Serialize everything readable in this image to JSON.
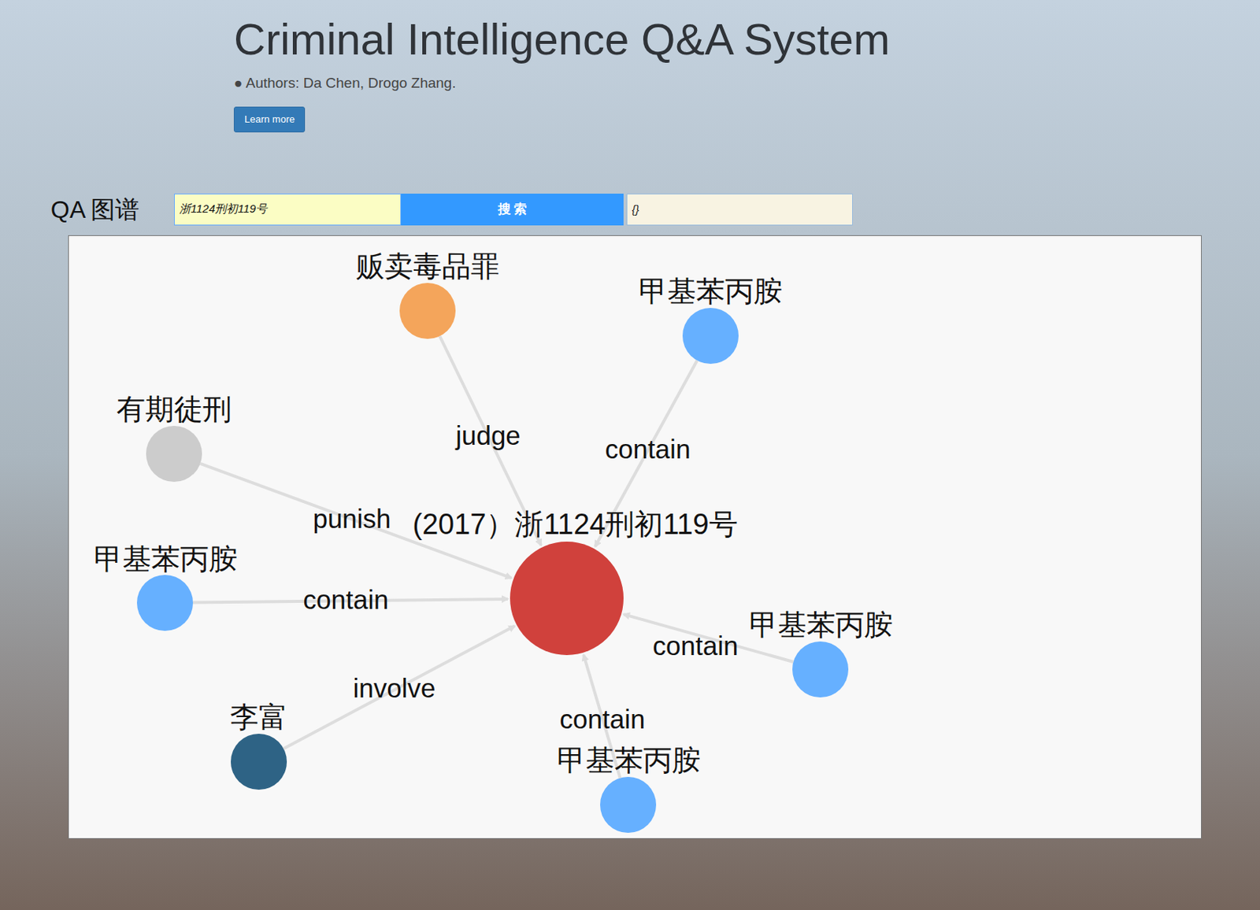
{
  "header": {
    "title": "Criminal Intelligence Q&A System",
    "authors": "● Authors: Da Chen, Drogo Zhang.",
    "button": "Learn more"
  },
  "query": {
    "label": "QA 图谱",
    "input_value": "浙1124刑初119号",
    "search_button": "搜 索",
    "result_value": "{}"
  },
  "graph": {
    "center": {
      "label": "(2017）浙1124刑初119号",
      "color": "#d0413c"
    },
    "nodes": [
      {
        "label": "贩卖毒品罪",
        "relation": "judge",
        "color": "#f4a55b"
      },
      {
        "label": "甲基苯丙胺",
        "relation": "contain",
        "color": "#66b0ff"
      },
      {
        "label": "有期徒刑",
        "relation": "punish",
        "color": "#cccccc"
      },
      {
        "label": "甲基苯丙胺",
        "relation": "contain",
        "color": "#66b0ff"
      },
      {
        "label": "李富",
        "relation": "involve",
        "color": "#2e6385"
      },
      {
        "label": "甲基苯丙胺",
        "relation": "contain",
        "color": "#66b0ff"
      },
      {
        "label": "甲基苯丙胺",
        "relation": "contain",
        "color": "#66b0ff"
      }
    ]
  }
}
